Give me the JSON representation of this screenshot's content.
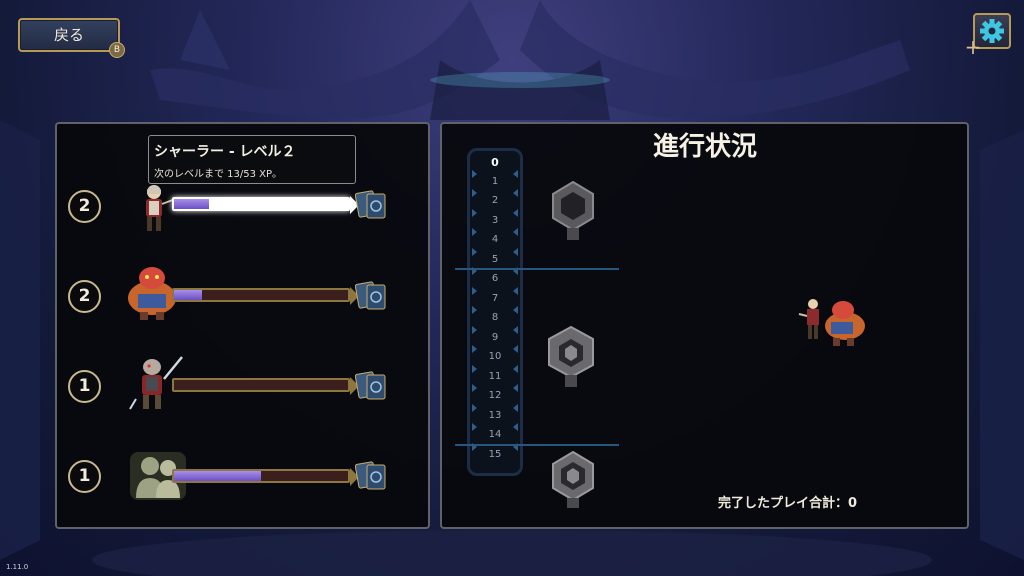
{
  "header": {
    "back_label": "戻る",
    "back_hotkey": "B"
  },
  "tooltip": {
    "title": "シャーラー - レベル２",
    "subtitle": "次のレベルまで 13/53 XP。"
  },
  "characters": [
    {
      "name_icon": "sharla-portrait-icon",
      "level": "2",
      "xp_fraction": 0.2,
      "selected": true
    },
    {
      "name_icon": "ogre-portrait-icon",
      "level": "2",
      "xp_fraction": 0.16,
      "selected": false
    },
    {
      "name_icon": "ratkin-portrait-icon",
      "level": "1",
      "xp_fraction": 0.0,
      "selected": false
    },
    {
      "name_icon": "party-placeholder-icon",
      "level": "1",
      "xp_fraction": 0.5,
      "selected": false
    }
  ],
  "progress": {
    "title": "進行状況",
    "track_numbers": [
      "0",
      "1",
      "2",
      "3",
      "4",
      "5",
      "6",
      "7",
      "8",
      "9",
      "10",
      "11",
      "12",
      "13",
      "14",
      "15"
    ],
    "current": "0",
    "total_plays_label": "完了したプレイ合計：0"
  },
  "footer": {
    "version": "1.11.0"
  },
  "colors": {
    "gold_border": "#b79a56",
    "xp_fill": "#8a6fe0",
    "panel_bg": "#07090c",
    "divider": "#28577d"
  }
}
